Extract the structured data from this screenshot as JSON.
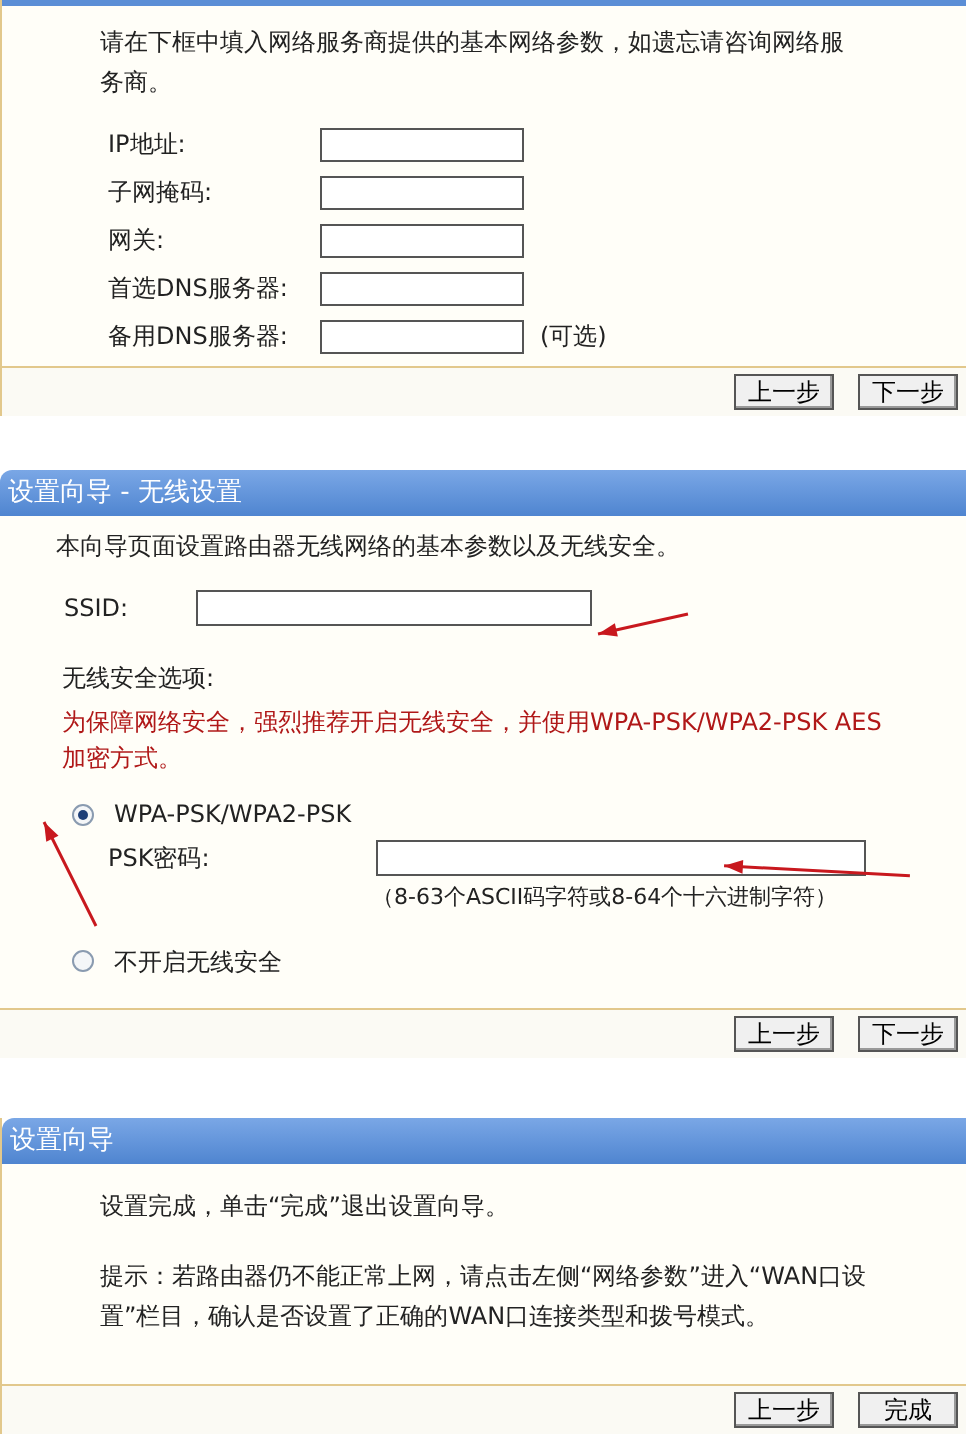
{
  "network_panel": {
    "intro": "请在下框中填入网络服务商提供的基本网络参数，如遗忘请咨询网络服务商。",
    "fields": [
      {
        "label": "IP地址:"
      },
      {
        "label": "子网掩码:"
      },
      {
        "label": "网关:"
      },
      {
        "label": "首选DNS服务器:"
      },
      {
        "label": "备用DNS服务器:",
        "note": "(可选)"
      }
    ],
    "buttons": [
      "上一步",
      "下一步"
    ]
  },
  "wireless_panel": {
    "title": "设置向导 - 无线设置",
    "intro": "本向导页面设置路由器无线网络的基本参数以及无线安全。",
    "ssid_label": "SSID:",
    "security_heading": "无线安全选项:",
    "warning": "为保障网络安全，强烈推荐开启无线安全，并使用WPA-PSK/WPA2-PSK AES加密方式。",
    "options": [
      {
        "label": "WPA-PSK/WPA2-PSK",
        "selected": true
      },
      {
        "label": "不开启无线安全",
        "selected": false
      }
    ],
    "psk_label": "PSK密码:",
    "psk_hint": "（8-63个ASCII码字符或8-64个十六进制字符）",
    "buttons": [
      "上一步",
      "下一步"
    ]
  },
  "done_panel": {
    "title": "设置向导",
    "message": "设置完成，单击“完成”退出设置向导。",
    "tip": "提示：若路由器仍不能正常上网，请点击左侧“网络参数”进入“WAN口设置”栏目，确认是否设置了正确的WAN口连接类型和拨号模式。",
    "buttons": [
      "上一步",
      "完成"
    ]
  }
}
